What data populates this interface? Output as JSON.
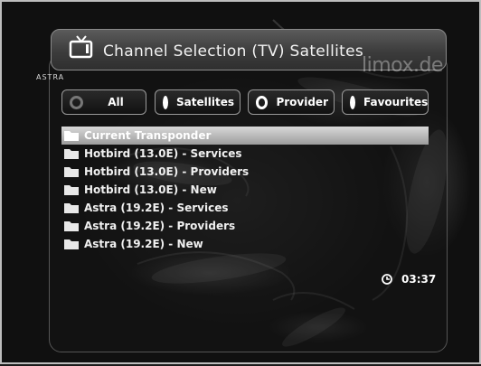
{
  "header": {
    "title": "Channel Selection  (TV) Satellites",
    "icon": "tv-icon",
    "logo_text": "ASTRA",
    "watermark": "limox.de"
  },
  "tabs": [
    {
      "label": "All",
      "selected": false,
      "dot_color": "#777777"
    },
    {
      "label": "Satellites",
      "selected": false,
      "dot_color": "#ffffff"
    },
    {
      "label": "Provider",
      "selected": false,
      "dot_color": "#ffffff"
    },
    {
      "label": "Favourites",
      "selected": false,
      "dot_color": "#ffffff"
    }
  ],
  "list": {
    "items": [
      {
        "label": "Current Transponder",
        "icon": "folder-icon",
        "selected": true
      },
      {
        "label": "Hotbird (13.0E) - Services",
        "icon": "folder-icon",
        "selected": false
      },
      {
        "label": "Hotbird (13.0E) - Providers",
        "icon": "folder-icon",
        "selected": false
      },
      {
        "label": "Hotbird (13.0E) - New",
        "icon": "folder-icon",
        "selected": false
      },
      {
        "label": "Astra (19.2E) - Services",
        "icon": "folder-icon",
        "selected": false
      },
      {
        "label": "Astra (19.2E) - Providers",
        "icon": "folder-icon",
        "selected": false
      },
      {
        "label": "Astra (19.2E) - New",
        "icon": "folder-icon",
        "selected": false
      }
    ]
  },
  "status": {
    "clock_icon": "clock-icon",
    "time": "03:37"
  },
  "colors": {
    "selection": "#bdbdbd",
    "text": "#ffffff"
  }
}
